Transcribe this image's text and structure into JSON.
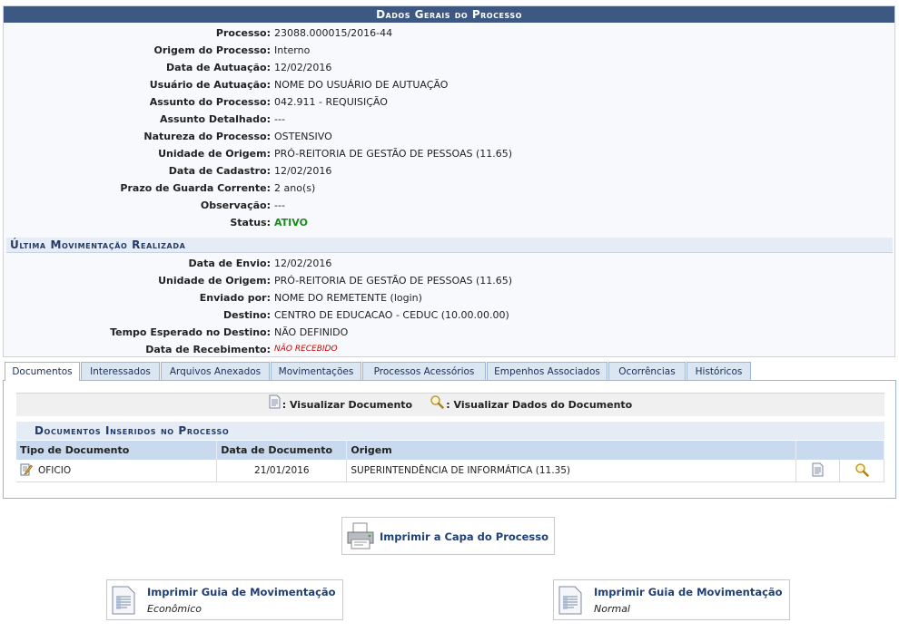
{
  "panel": {
    "title": "Dados Gerais do Processo",
    "rows": [
      {
        "label": "Processo:",
        "value": "23088.000015/2016-44"
      },
      {
        "label": "Origem do Processo:",
        "value": "Interno"
      },
      {
        "label": "Data de Autuação:",
        "value": "12/02/2016"
      },
      {
        "label": "Usuário de Autuação:",
        "value": "NOME DO USUÁRIO DE AUTUAÇÃO"
      },
      {
        "label": "Assunto do Processo:",
        "value": "042.911 - REQUISIÇÃO"
      },
      {
        "label": "Assunto Detalhado:",
        "value": "---"
      },
      {
        "label": "Natureza do Processo:",
        "value": "OSTENSIVO"
      },
      {
        "label": "Unidade de Origem:",
        "value": "PRÓ-REITORIA DE GESTÃO DE PESSOAS (11.65)"
      },
      {
        "label": "Data de Cadastro:",
        "value": "12/02/2016"
      },
      {
        "label": "Prazo de Guarda Corrente:",
        "value": "2 ano(s)"
      },
      {
        "label": "Observação:",
        "value": "---"
      },
      {
        "label": "Status:",
        "value": "ATIVO"
      }
    ],
    "status_color": "#1e8a1e"
  },
  "movement": {
    "title": "Última Movimentação Realizada",
    "rows": [
      {
        "label": "Data de Envio:",
        "value": "12/02/2016"
      },
      {
        "label": "Unidade de Origem:",
        "value": "PRÓ-REITORIA DE GESTÃO DE PESSOAS (11.65)"
      },
      {
        "label": "Enviado por:",
        "value": "NOME DO REMETENTE (login)"
      },
      {
        "label": "Destino:",
        "value": "CENTRO DE EDUCACAO - CEDUC (10.00.00.00)"
      },
      {
        "label": "Tempo Esperado no Destino:",
        "value": "NÃO DEFINIDO"
      },
      {
        "label": "Data de Recebimento:",
        "value": "NÃO RECEBIDO"
      }
    ]
  },
  "tabs": [
    "Documentos",
    "Interessados",
    "Arquivos Anexados",
    "Movimentações",
    "Processos Acessórios",
    "Empenhos Associados",
    "Ocorrências",
    "Históricos"
  ],
  "active_tab": "Documentos",
  "legend": {
    "view_doc": ": Visualizar Documento",
    "view_data": ": Visualizar Dados do Documento"
  },
  "documents": {
    "title": "Documentos Inseridos no Processo",
    "columns": [
      "Tipo de Documento",
      "Data de Documento",
      "Origem"
    ],
    "rows": [
      {
        "tipo": "OFICIO",
        "data": "21/01/2016",
        "origem": "SUPERINTENDÊNCIA DE INFORMÁTICA (11.35)"
      }
    ]
  },
  "buttons": {
    "print_cover": "Imprimir a Capa do Processo",
    "guide_economic_title": "Imprimir Guia de Movimentação",
    "guide_economic_sub": "Econômico",
    "guide_normal_title": "Imprimir Guia de Movimentação",
    "guide_normal_sub": "Normal"
  },
  "colors": {
    "header_bg": "#3c5883",
    "link": "#1f3f77",
    "status_ok": "#1e8a1e",
    "warning": "#d10000"
  }
}
